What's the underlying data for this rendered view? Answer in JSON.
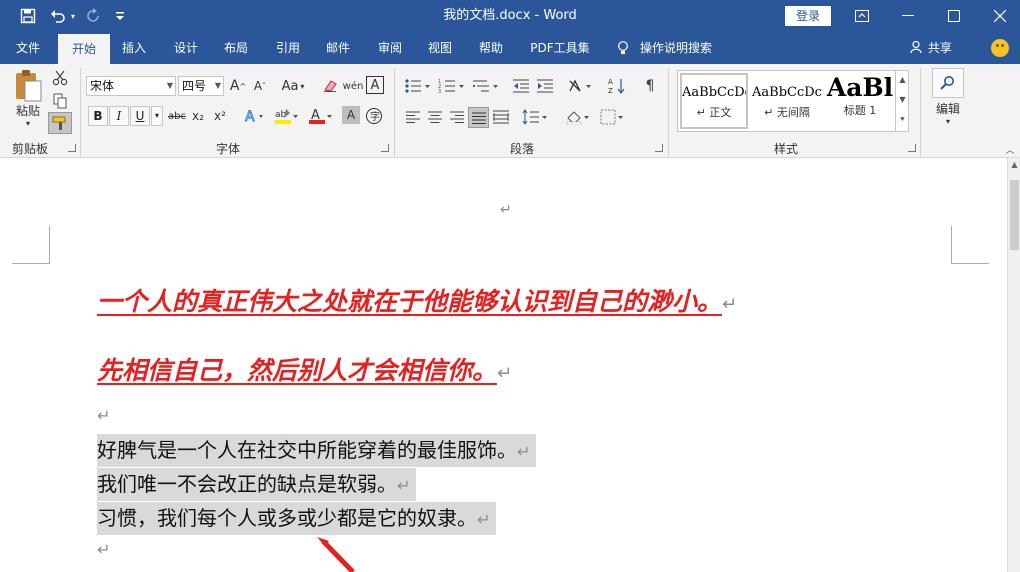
{
  "window": {
    "title": "我的文档.docx - Word",
    "login_label": "登录"
  },
  "tabs": [
    {
      "label": "文件"
    },
    {
      "label": "开始"
    },
    {
      "label": "插入"
    },
    {
      "label": "设计"
    },
    {
      "label": "布局"
    },
    {
      "label": "引用"
    },
    {
      "label": "邮件"
    },
    {
      "label": "审阅"
    },
    {
      "label": "视图"
    },
    {
      "label": "帮助"
    },
    {
      "label": "PDF工具集"
    }
  ],
  "tell_me": "操作说明搜索",
  "share_label": "共享",
  "ribbon": {
    "clipboard": {
      "paste_label": "粘贴",
      "group_label": "剪贴板"
    },
    "font": {
      "font_name": "宋体",
      "font_size": "四号",
      "group_label": "字体",
      "buttons": {
        "bold": "B",
        "italic": "I",
        "underline": "U",
        "strike": "abc",
        "subscript": "x₂",
        "superscript": "x²",
        "aa": "Aa",
        "grow": "A",
        "shrink": "A",
        "wen": "wén",
        "border_a": "A"
      }
    },
    "paragraph": {
      "group_label": "段落"
    },
    "styles": {
      "group_label": "样式",
      "items": [
        {
          "preview": "AaBbCcDc",
          "name": "正文"
        },
        {
          "preview": "AaBbCcDc",
          "name": "无间隔"
        },
        {
          "preview": "AaBl",
          "name": "标题 1"
        }
      ]
    },
    "editing": {
      "label": "编辑"
    }
  },
  "document": {
    "headings": [
      "一个人的真正伟大之处就在于他能够认识到自己的渺小。",
      "先相信自己，然后别人才会相信你。"
    ],
    "body_lines": [
      "好脾气是一个人在社交中所能穿着的最佳服饰。",
      "我们唯一不会改正的缺点是软弱。",
      "习惯，我们每个人或多或少都是它的奴隶。"
    ],
    "paragraph_mark": "↵"
  },
  "colors": {
    "titlebar": "#2b579a",
    "heading_text": "#e52120",
    "selection": "#d9d9d9",
    "arrow": "#e52120"
  }
}
